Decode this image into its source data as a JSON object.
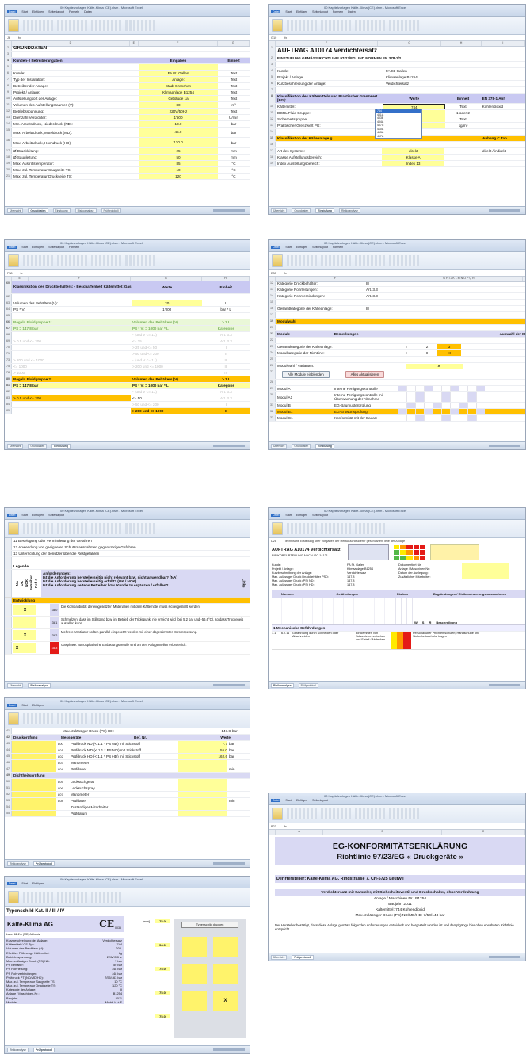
{
  "app": {
    "tabs": [
      "Datei",
      "Start",
      "Einfügen",
      "Seitenlayout",
      "Formeln",
      "Daten",
      "Überprüfen",
      "Ansicht",
      "Entwickler",
      "Add-Ins"
    ],
    "title": "00 Kapitelvorlagen Kälte-Klima (CE).xlsm - Microsoft Excel"
  },
  "s1": {
    "namebox": "J6",
    "cols": [
      "D",
      "E",
      "F",
      "G"
    ],
    "title": "GRUNDDATEN",
    "header": {
      "label": "Kunden- / Betreiberangaben:",
      "value": "Eingaben",
      "unit": "Einheit"
    },
    "rows": [
      {
        "n": "5",
        "label": "",
        "value": "",
        "unit": ""
      },
      {
        "n": "6",
        "label": "Kunde:",
        "value": "FA St. Gallen",
        "unit": "Text"
      },
      {
        "n": "7",
        "label": "Typ der Installation:",
        "value": "Anlage:",
        "unit": "Text"
      },
      {
        "n": "8",
        "label": "Betreiber der Anlage:",
        "value": "Stadt Grenchen",
        "unit": "Text"
      },
      {
        "n": "9",
        "label": "Projekt / Anlage:",
        "value": "Klimaanlage B1254",
        "unit": "Text"
      },
      {
        "n": "10",
        "label": "Aufstellungsort der Anlage:",
        "value": "Gebäude 1a",
        "unit": "Text"
      },
      {
        "n": "11",
        "label": "Volumen des Aufstellungsraumes (V):",
        "value": "80",
        "unit": "m³"
      },
      {
        "n": "12",
        "label": "Betriebsspannung:",
        "value": "220V/50Hz",
        "unit": "Text"
      },
      {
        "n": "13",
        "label": "Drehzahl Verdichter:",
        "value": "1'500",
        "unit": "U/min"
      },
      {
        "n": "14",
        "label": "Min. Arbeitsdruck, Niederdruck (ND):",
        "value": "13.0",
        "unit": "bar"
      },
      {
        "n": "15",
        "label": "Max. Arbeitsdruck, Mitteldruck (MD):",
        "value": "45.0",
        "unit": "bar"
      },
      {
        "n": "16",
        "label": "Max. Arbeitsdruck, Hochdruck (HD):",
        "value": "120.0",
        "unit": "bar"
      },
      {
        "n": "17",
        "label": "Ø Druckleitung:",
        "value": "25",
        "unit": "mm"
      },
      {
        "n": "18",
        "label": "Ø Saugleitung:",
        "value": "50",
        "unit": "mm"
      },
      {
        "n": "19",
        "label": "Max. Austrittstemperatur:",
        "value": "85",
        "unit": "°C"
      },
      {
        "n": "20",
        "label": "Max. zul. Temperatur Saugseite TS:",
        "value": "10",
        "unit": "°C"
      },
      {
        "n": "21",
        "label": "Max. zul. Temperatur Druckseite TS:",
        "value": "120",
        "unit": "°C"
      }
    ],
    "sheets": [
      "Übersicht",
      "Grunddaten",
      "Einstufung",
      "Risikoanalyse",
      "Prüfprotokoll"
    ]
  },
  "s2": {
    "namebox": "G10",
    "cols": [
      "F",
      "G",
      "H",
      "I"
    ],
    "title": "AUFTRAG A10174 Verdichtersatz",
    "subtitle": "EINSTUFUNG GEMÄSS RICHTLINIE 97/23/EG UND NORMEN EN 378-1/2",
    "info": [
      {
        "n": "4",
        "label": "Kunde:",
        "value": "FA St. Gallen"
      },
      {
        "n": "5",
        "label": "Projekt / Anlage:",
        "value": "Klimaanlage B1254"
      },
      {
        "n": "6",
        "label": "Kurzbeschreibung der Anlage:",
        "value": "Verdichtersatz"
      }
    ],
    "header": {
      "label": "Klassifikation des Kältemittels und Praktischer Grenzwert [PG]:",
      "value": "Werte",
      "unit": "Einheit",
      "norm": "EN 378-1 Anh"
    },
    "rows": [
      {
        "n": "10",
        "label": "Kältemittel:",
        "value": "744",
        "unit": "Text",
        "extra": "Kohlendioxid"
      },
      {
        "n": "11",
        "label": "DGRL Fluid Gruppe:",
        "value": "",
        "unit": "1 oder 2",
        "extra": ""
      },
      {
        "n": "12",
        "label": "Sicherheitsgruppe:",
        "value": "",
        "unit": "Text",
        "extra": ""
      },
      {
        "n": "13",
        "label": "Praktischer Grenzwert PG:",
        "value": "",
        "unit": "kg/m³",
        "extra": ""
      }
    ],
    "dropdown": [
      "744",
      "401A",
      "403B",
      "404A",
      "407C",
      "410A",
      "413A",
      "417A"
    ],
    "section": {
      "label": "Klassifikation der Kälteanlage g",
      "extra": "Anhang C Tab"
    },
    "rows2": [
      {
        "n": "17",
        "label": "Art des Systems:",
        "value": "direkt",
        "extra": "direkt / indirekt"
      },
      {
        "n": "18",
        "label": "Klasse Aufstellungsbereich:",
        "value": "Klasse A",
        "extra": ""
      },
      {
        "n": "19",
        "label": "Index Aufstellungsbereich:",
        "value": "Index 13",
        "extra": ""
      }
    ]
  },
  "s3": {
    "namebox": "F58",
    "cols": [
      "E",
      "F",
      "G",
      "H"
    ],
    "header": {
      "label": "Klassifikation des Druckbehälters: - Beschaffenheit Kältemittel: Gas",
      "value": "Werte",
      "unit": "Einheit"
    },
    "vol": [
      {
        "n": "63",
        "label": "Volumen des Behälters (V):",
        "value": "20",
        "unit": "L"
      },
      {
        "n": "64",
        "label": "PS * V:",
        "value": "1'000",
        "unit": "bar * L"
      }
    ],
    "g1": {
      "n": "66",
      "label": "Regeln Fluidgruppe 1:",
      "value": "Volumen des Behälters (V)",
      "unit": "> 1 L"
    },
    "g1b": {
      "n": "67",
      "label": "PS = 147.8 bar",
      "value": "PS * V: = 1000 bar * L",
      "unit": "Kategorie"
    },
    "g1rows": [
      {
        "n": "68",
        "label": "",
        "value": "- (und V <= 1L)",
        "unit": "Art. 3.3"
      },
      {
        "n": "69",
        "label": "> 0.5 und <= 200",
        "value": "<= 25",
        "unit": "Art. 3.3"
      },
      {
        "n": "70",
        "label": "",
        "value": "> 25 und <= 50",
        "unit": "I"
      },
      {
        "n": "71",
        "label": "",
        "value": "> 50 und <= 200",
        "unit": "II"
      },
      {
        "n": "73",
        "label": "> 200 und <= 1000",
        "value": "- (und V <= 1L)",
        "unit": "III"
      },
      {
        "n": "75",
        "label": "<= 1000",
        "value": "> 200 und <= 1000",
        "unit": "III"
      },
      {
        "n": "78",
        "label": "> 1000",
        "value": "",
        "unit": "IV"
      }
    ],
    "g2": {
      "n": "80",
      "label": "Regeln Fluidgruppe 2:",
      "value": "Volumen des Behälters (V)",
      "unit": "> 1 L"
    },
    "g2b": {
      "n": "81",
      "label": "PS = 147.8 bar",
      "value": "PS * V: = 1000 bar * L",
      "unit": "Kategorie"
    },
    "g2rows": [
      {
        "n": "82",
        "label": "",
        "value": "- (und V <= 1L)",
        "unit": "Art. 3.3"
      },
      {
        "n": "83",
        "label": "> 0.5 und <= 200",
        "value": "<= 50",
        "unit": "Art. 3.3"
      },
      {
        "n": "84",
        "label": "",
        "value": "> 50 und <= 200",
        "unit": "I"
      },
      {
        "n": "85",
        "label": "",
        "value": "> 200 und <= 1000",
        "unit": "II"
      }
    ]
  },
  "s4": {
    "namebox": "E30",
    "cols": [
      "F",
      "G H I J K L M N O P Q R"
    ],
    "rows": [
      {
        "n": "12",
        "label": "Kategorie Druckbehälter:",
        "value": "III"
      },
      {
        "n": "13",
        "label": "Kategorie Rohrleitungen:",
        "value": "Art. 3.3"
      },
      {
        "n": "14",
        "label": "Kategorie Rohrverbindungen:",
        "value": "Art. 3.3"
      }
    ],
    "gesamt": {
      "n": "16",
      "label": "Gesamtkategorie der Kälteanlage:",
      "value": "III"
    },
    "section": "Modulwahl",
    "modhdr": {
      "label": "Module",
      "remark": "Bemerkungen",
      "sel": "Auswahl der M"
    },
    "gk": [
      {
        "n": "23",
        "label": "Gesamtkategorie der Kälteanlage:",
        "v1": "I",
        "v2": "2",
        "v3": "3"
      },
      {
        "n": "24",
        "label": "Modulkategorie der Richtline:",
        "v1": "I",
        "v2": "II",
        "v3": "III"
      }
    ],
    "modvar": "Modulwahl / Varianten:",
    "mark": "X",
    "btn1": "Alle Module einblenden",
    "btn2": "Alles Aktualisieren",
    "modules": [
      {
        "n": "29",
        "name": "Modul A",
        "remark": "Interne Fertigungskontrolle"
      },
      {
        "n": "30",
        "name": "Modul A1",
        "remark": "Interne Fertigungskontrolle mit Überwachung der Abnahme"
      },
      {
        "n": "31",
        "name": "Modul B",
        "remark": "EG-Baumusterprüfung"
      },
      {
        "n": "32",
        "name": "Modul B1",
        "remark": "EG-Entwurfsprüfung"
      },
      {
        "n": "33",
        "name": "Modul C1",
        "remark": "Konformität mit der Bauart"
      }
    ]
  },
  "s5": {
    "lines": [
      "11  Beseitigung oder Verminderung der Gefahren",
      "12  Anwendung von geeigneten Schutzmassnahmen gegen übrige Gefahren",
      "13  Unterrichtung der Benutzer über die Restgefahren"
    ],
    "legend": "Legende:",
    "anf": "Anforderungen:",
    "q": [
      "Ist die Anforderung herstellerseitig nicht relevant bzw. nicht anwendbar? (NA)",
      "Ist die Anforderung herstellerseitig erfüllt? (OK / NOK)",
      "Ist die Anforderung seitens Betreiber bzw. Kunde zu ergänzen / erfüllen?"
    ],
    "vert": [
      "NA",
      "OK",
      "NOK",
      "Betreiber",
      "Ref. #"
    ],
    "side": "Links",
    "section": "Entwicklung",
    "items": [
      {
        "ref": "380",
        "text": "Die Kompatibilität der eingesetzten Materialien mit dem Kältemittel muss sichergestellt werden."
      },
      {
        "ref": "381",
        "text": "Schmelzen, dass im Stillstand bzw. im Betrieb der Triplepunkt nie erreicht wird (bei 5.2 bar und -56.6°C), so dass Trockeneis ausfallen kann."
      },
      {
        "ref": "382",
        "text": "Mehrere Ventilator sollten parallel eingesetzt werden mit einer abgestimmten Stromspeisung."
      },
      {
        "ref": "383",
        "text": "Gasphase: atmosphärische Entlastungsventile sind an den Anlagenteilen erforderlich."
      }
    ],
    "x": "X"
  },
  "s6": {
    "namebox": "D28",
    "title": "AUFTRAG A10174 Verdichtersatz",
    "sub": "RISIKOBEURTEILUNG NACH ISO 14121",
    "banner": "Technische Erstellung über Vorgaben der Herausschleuderer geschützten Teile der Anlage",
    "info": [
      {
        "label": "Kunde:",
        "value": "FA St. Gallen"
      },
      {
        "label": "Projekt / Anlage:",
        "value": "Klimaanlage B1254"
      },
      {
        "label": "Kurzbeschreibung der Anlage:",
        "value": "Verdichtersatz"
      },
      {
        "label": "Max. zulässiger Druck Druckbehälter PSD:",
        "value": "147.8"
      },
      {
        "label": "Max. zulässiger Druck (PS) ND:",
        "value": "147.8"
      },
      {
        "label": "Max. zulässiger Druck (PS) HD:",
        "value": "147.8"
      }
    ],
    "info2": [
      {
        "label": "Dokumentiert für:",
        "value": ""
      },
      {
        "label": "Anlage / Maschinen Nr.:",
        "value": ""
      },
      {
        "label": "Datum der Auslegung:",
        "value": ""
      },
      {
        "label": "Zusätzlicher Mitarbeiter:",
        "value": ""
      }
    ],
    "hdr": [
      "Nummer",
      "Gefährdungen",
      "Risiken",
      "Begründungen / Risikominderungsmassnahmen"
    ],
    "section": "1  Mechanische Gefährdungen",
    "row": {
      "n": "1.1",
      "ref": "6.2.11",
      "text": "Gefährdung durch Schneiden oder Abschneiden",
      "cause": "Einklemmen von Scharnieren zwischen und Fixteil / Abdecken",
      "fix": "Personal über Pflichten schulen; Handschuhe und Sicherheitsschuhe tragen"
    },
    "legend": [
      "W",
      "S",
      "R",
      "Beschreibung"
    ],
    "sheets": [
      "Risikoanalyse",
      "Prüfprotokoll"
    ]
  },
  "s7": {
    "top": {
      "label": "Max. zulässiger Druck (PS) HD:",
      "value": "147.8",
      "unit": "bar"
    },
    "hdr": {
      "g": "Druckprüfung",
      "m": "Messgeräte",
      "r": "Ref. Nr.",
      "w": "Werte"
    },
    "rows": [
      {
        "ref": "800",
        "label": "Prüfdruck ND (< 1.1 * PS ND) mit Stickstoff",
        "value": "7.7",
        "unit": "bar"
      },
      {
        "ref": "801",
        "label": "Prüfdruck MD (< 1.1 * PS MD) mit Stickstoff",
        "value": "55.0",
        "unit": "bar"
      },
      {
        "ref": "802",
        "label": "Prüfdruck HD (< 1.1 * PS HD) mit Stickstoff",
        "value": "162.6",
        "unit": "bar"
      },
      {
        "ref": "803",
        "label": "Manometer",
        "value": "",
        "unit": ""
      },
      {
        "ref": "804",
        "label": "Prüfdauer",
        "value": "",
        "unit": "min"
      }
    ],
    "hdr2": "Dichtheitsprüfung",
    "rows2": [
      {
        "ref": "805",
        "label": "Lecksuchgerät",
        "value": "",
        "unit": ""
      },
      {
        "ref": "806",
        "label": "Lecksuchspray",
        "value": "",
        "unit": ""
      },
      {
        "ref": "807",
        "label": "Manometer",
        "value": "",
        "unit": ""
      },
      {
        "ref": "808",
        "label": "Prüfdauer",
        "value": "",
        "unit": "min"
      },
      {
        "ref": "",
        "label": "Zuständiger Mitarbeiter",
        "value": "",
        "unit": ""
      },
      {
        "ref": "",
        "label": "Prüfdatum",
        "value": "",
        "unit": ""
      }
    ]
  },
  "s8": {
    "namebox": "B23",
    "cols": [
      "A",
      "B",
      "C"
    ],
    "title": "EG-KONFORMITÄTSERKLÄRUNG",
    "subtitle": "Richtlinie 97/23/EG « Druckgeräte »",
    "maker": "Der Hersteller: Kälte-Klima AG, Ringstrasse 7, CH-5725 Leutwil",
    "desc": "Verdichtersatz mit Sammler, mit Sicherheitsventil und Druckschalter, ohne Verdrahtung",
    "lines": [
      "Anlage / Maschinen Nr.: B1254",
      "Baujahr: 2011",
      "Kältemittel: 744 Kohlendioxid",
      "Max. zulässiger Druck (PS) ND/MD/HD: 7/50/148 bar"
    ],
    "foot": "Der Hersteller bestätigt, dass diese Anlage gemäss folgenden Anforderungen entwickelt und hergestellt worden ist und dampfgänge hier oben erwähnten Richtlinie entspricht.",
    "rn": [
      "1",
      "2",
      "3",
      "4",
      "5",
      "6",
      "7",
      "8",
      "9",
      "10",
      "11",
      "12",
      "13",
      "14",
      "15",
      "16",
      "17"
    ]
  },
  "s9": {
    "title": "Typenschild Kat. II / III / IV",
    "company": "Kälte-Klima AG",
    "ce": "CE",
    "ce_num": "0035",
    "btn": "Typenschild drucken",
    "sub": "Label 62.2m (MD) Adhesiv",
    "rows": [
      {
        "label": "Kurzbeschreibung der Anlage:",
        "value": "Verdichtersatz"
      },
      {
        "label": "Kältemittel / CS-Typ:",
        "value": "744"
      },
      {
        "label": "Volumen des Behälters (V):",
        "value": "20 L"
      },
      {
        "label": "Effektive Füllmenge Kältemittel:",
        "value": "kg"
      },
      {
        "label": "Betriebsspannung:",
        "value": "220V/50Hz"
      },
      {
        "label": "Max. zulässiger Druck (PS) ND:",
        "value": "7 bar"
      },
      {
        "label": "PS Behälter:",
        "value": "50 bar"
      },
      {
        "label": "PS Rohrleitung:",
        "value": "148 bar"
      },
      {
        "label": "PS Rohrverbindungen:",
        "value": "148 bar"
      },
      {
        "label": "Prüfdruck PT (ND/MD/HD):",
        "value": "7/55/163 bar"
      },
      {
        "label": "Max. zul. Temperatur Saugseite TS:",
        "value": "10 °C"
      },
      {
        "label": "Max. zul. Temperatur Druckseite TS:",
        "value": "120 °C"
      },
      {
        "label": "Kategorie der Anlage:",
        "value": "III"
      },
      {
        "label": "Anlage / Maschinen-Nr.:",
        "value": "B1254"
      },
      {
        "label": "Baujahr:",
        "value": "2011"
      },
      {
        "label": "Module:",
        "value": "Modul H + F"
      }
    ],
    "side": [
      {
        "label": "[mm]",
        "value": "75.0"
      },
      {
        "label": "",
        "value": "54.0"
      },
      {
        "label": "",
        "value": "75.0"
      },
      {
        "label": "",
        "value": "75.0"
      },
      {
        "label": "",
        "value": "75.0"
      }
    ],
    "x": "X"
  }
}
